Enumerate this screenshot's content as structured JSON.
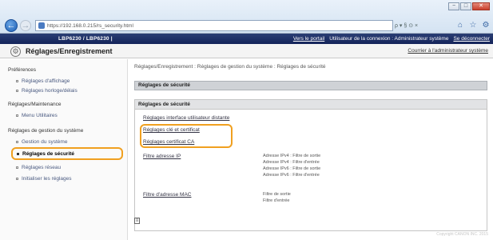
{
  "browser": {
    "url": "https://192.168.0.215/rs_security.html",
    "address_right": "ρ ▾ § ⊙ ×",
    "window_buttons": [
      "−",
      "□",
      "✕"
    ]
  },
  "header": {
    "printer_name": "LBP6230 / LBP6230 |",
    "portal_link": "Vers le portail",
    "user_info": "Utilisateur de la connexion : Administrateur système",
    "logout_link": "Se déconnecter"
  },
  "page": {
    "title": "Réglages/Enregistrement",
    "admin_link": "Courrier à l'administrateur système"
  },
  "sidebar": {
    "sections": [
      {
        "label": "Préférences",
        "items": [
          "Réglages d'affichage",
          "Réglages horloge/délais"
        ]
      },
      {
        "label": "Réglages/Maintenance",
        "items": [
          "Menu Utilitaires"
        ]
      },
      {
        "label": "Réglages de gestion du système",
        "items": [
          "Gestion du système",
          "Réglages de sécurité",
          "Réglages réseau",
          "Initialiser les réglages"
        ]
      }
    ]
  },
  "main": {
    "breadcrumb": "Réglages/Enregistrement : Réglages de gestion du système : Réglages de sécurité",
    "section_title": "Réglages de sécurité",
    "panel_title": "Réglages de sécurité",
    "links": {
      "remote_ui": "Réglages interface utilisateur distante",
      "key_cert": "Réglages clé et certificat",
      "ca_cert": "Réglages certificat CA",
      "ip_filter": "Filtre adresse IP",
      "mac_filter": "Filtre d'adresse MAC"
    },
    "ip_filter_values": [
      "Adresse IPv4 : Filtre de sortie",
      "Adresse IPv4 : Filtre d'entrée",
      "Adresse IPv6 : Filtre de sortie",
      "Adresse IPv6 : Filtre d'entrée"
    ],
    "mac_filter_values": [
      "Filtre de sortie",
      "Filtre d'entrée"
    ]
  },
  "footer": "Copyright CANON INC. 2015",
  "colors": {
    "header_bar": "#14245a",
    "highlight": "#f0a020",
    "section_bar": "#cfd2d6"
  }
}
